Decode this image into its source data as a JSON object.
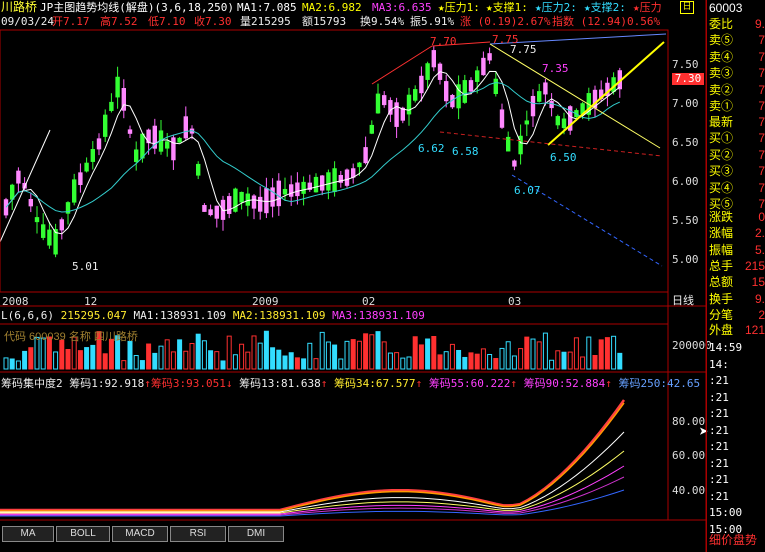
{
  "header": {
    "stock_name": "川路桥",
    "chart_title": "JP主图趋势均线(解盘)",
    "params": "(3,6,18,250)",
    "ma1": "MA1:7.085",
    "ma2": "MA2:6.982",
    "ma3": "MA3:6.635",
    "pressure1": "★压力1:",
    "support1": "★支撑1:",
    "pressure2": "★压力2:",
    "support2": "★支撑2:",
    "pressure3": "★压力",
    "code_fragment": "600039"
  },
  "quote_line": {
    "date": "09/03/24",
    "open": "开7.17",
    "high": "高7.52",
    "low": "低7.10",
    "close": "收7.30",
    "volume": "量215295",
    "amount": "额15793",
    "turnover": "换9.54%",
    "amplitude": "振5.91%",
    "change": "涨 (0.19)2.67%",
    "index": "指数 (12.94)0.56%"
  },
  "price_axis": [
    "7.50",
    "7.30",
    "7.00",
    "6.50",
    "6.00",
    "5.50",
    "5.00"
  ],
  "annotations": {
    "p770": "7.70",
    "p775a": "7.75",
    "p775b": "7.75",
    "p735": "7.35",
    "p662": "6.62",
    "p658": "6.58",
    "p650": "6.50",
    "p607": "6.07",
    "p501": "5.01"
  },
  "time_axis": [
    "2008",
    "12",
    "2009",
    "02",
    "03"
  ],
  "time_axis_right": "日线",
  "volume_panel": {
    "header": "L(6,6,6)",
    "vol": "215295.047",
    "ma1": "MA1:138931.109",
    "ma2": "MA2:138931.109",
    "ma3": "MA3:138931.109",
    "legend": "代码 600039 名称 四川路桥",
    "axis": "200000"
  },
  "chip_panel": {
    "title": "筹码集中度2",
    "c1": "筹码1:92.918",
    "c3": "筹码3:93.051",
    "c13": "筹码13:81.638",
    "c34": "筹码34:67.577",
    "c55": "筹码55:60.222",
    "c90": "筹码90:52.884",
    "c250": "筹码250:42.65",
    "axis": [
      "80.00",
      "60.00",
      "40.00"
    ]
  },
  "tabs": [
    "MA",
    "BOLL",
    "MACD",
    "RSI",
    "DMI"
  ],
  "right_panel": {
    "code": "60003",
    "wei_label": "委比",
    "wei_value": "9.",
    "sell_rows": [
      {
        "label": "卖⑤",
        "value": "7"
      },
      {
        "label": "卖④",
        "value": "7"
      },
      {
        "label": "卖③",
        "value": "7"
      },
      {
        "label": "卖②",
        "value": "7"
      },
      {
        "label": "卖①",
        "value": "7"
      }
    ],
    "latest": "最新",
    "latest_value": "7",
    "buy_rows": [
      {
        "label": "买①",
        "value": "7"
      },
      {
        "label": "买②",
        "value": "7"
      },
      {
        "label": "买③",
        "value": "7"
      },
      {
        "label": "买④",
        "value": "7"
      },
      {
        "label": "买⑤",
        "value": "7"
      }
    ],
    "stats": [
      {
        "label": "涨跌",
        "value": "0"
      },
      {
        "label": "涨幅",
        "value": "2."
      },
      {
        "label": "振幅",
        "value": "5."
      },
      {
        "label": "总手",
        "value": "215"
      },
      {
        "label": "总额",
        "value": "15"
      },
      {
        "label": "换手",
        "value": "9."
      },
      {
        "label": "分笔",
        "value": "2"
      }
    ],
    "outer": "外盘",
    "outer_value": "121",
    "times": [
      "14:59",
      "14:",
      ":21",
      ":21",
      ":21",
      ":21",
      ":21",
      ":21",
      ":21",
      ":21",
      "15:00",
      "15:00"
    ],
    "detail_link": "细价盘势",
    "price_badge": "7.30"
  }
}
